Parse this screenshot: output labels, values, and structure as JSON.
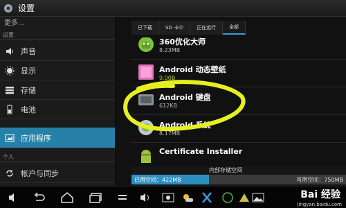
{
  "titlebar": {
    "title": "设置"
  },
  "left": {
    "more": "更多...",
    "section_settings": "设置",
    "items": [
      {
        "label": "声音",
        "icon": "speaker-icon"
      },
      {
        "label": "显示",
        "icon": "brightness-icon"
      },
      {
        "label": "存储",
        "icon": "storage-icon"
      },
      {
        "label": "电池",
        "icon": "battery-icon"
      },
      {
        "label": "应用程序",
        "icon": "apps-icon"
      }
    ],
    "section_personal": "个人",
    "account_item": {
      "label": "帐户与同步",
      "icon": "sync-icon"
    }
  },
  "tabs": [
    "已下载",
    "SD 卡中",
    "正在运行",
    "全部"
  ],
  "active_tab": "全部",
  "apps": [
    {
      "name": "360优化大师",
      "size": "8.23MB"
    },
    {
      "name": "Android 动态壁纸",
      "size": "9.00B"
    },
    {
      "name": "Android 键盘",
      "size": "612KB"
    },
    {
      "name": "Android 系统",
      "size": "8.17MB"
    },
    {
      "name": "Certificate Installer",
      "size": ""
    }
  ],
  "storage": {
    "label": "内部存储空间",
    "used": "已用空间：422MB",
    "free": "可用空间：750MB"
  },
  "watermark": {
    "main": "Bai 经验",
    "sub": "jingyan.baidu.com"
  },
  "colors": {
    "accent": "#2680a7",
    "annotation": "#e6f020"
  }
}
